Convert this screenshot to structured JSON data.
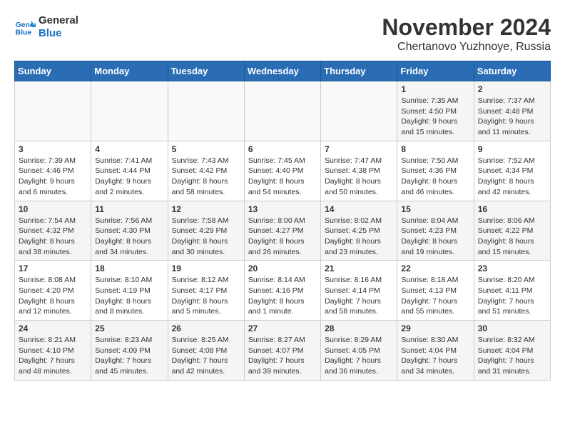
{
  "logo": {
    "line1": "General",
    "line2": "Blue"
  },
  "title": "November 2024",
  "subtitle": "Chertanovo Yuzhnoye, Russia",
  "days_of_week": [
    "Sunday",
    "Monday",
    "Tuesday",
    "Wednesday",
    "Thursday",
    "Friday",
    "Saturday"
  ],
  "weeks": [
    [
      {
        "day": "",
        "info": ""
      },
      {
        "day": "",
        "info": ""
      },
      {
        "day": "",
        "info": ""
      },
      {
        "day": "",
        "info": ""
      },
      {
        "day": "",
        "info": ""
      },
      {
        "day": "1",
        "info": "Sunrise: 7:35 AM\nSunset: 4:50 PM\nDaylight: 9 hours and 15 minutes."
      },
      {
        "day": "2",
        "info": "Sunrise: 7:37 AM\nSunset: 4:48 PM\nDaylight: 9 hours and 11 minutes."
      }
    ],
    [
      {
        "day": "3",
        "info": "Sunrise: 7:39 AM\nSunset: 4:46 PM\nDaylight: 9 hours and 6 minutes."
      },
      {
        "day": "4",
        "info": "Sunrise: 7:41 AM\nSunset: 4:44 PM\nDaylight: 9 hours and 2 minutes."
      },
      {
        "day": "5",
        "info": "Sunrise: 7:43 AM\nSunset: 4:42 PM\nDaylight: 8 hours and 58 minutes."
      },
      {
        "day": "6",
        "info": "Sunrise: 7:45 AM\nSunset: 4:40 PM\nDaylight: 8 hours and 54 minutes."
      },
      {
        "day": "7",
        "info": "Sunrise: 7:47 AM\nSunset: 4:38 PM\nDaylight: 8 hours and 50 minutes."
      },
      {
        "day": "8",
        "info": "Sunrise: 7:50 AM\nSunset: 4:36 PM\nDaylight: 8 hours and 46 minutes."
      },
      {
        "day": "9",
        "info": "Sunrise: 7:52 AM\nSunset: 4:34 PM\nDaylight: 8 hours and 42 minutes."
      }
    ],
    [
      {
        "day": "10",
        "info": "Sunrise: 7:54 AM\nSunset: 4:32 PM\nDaylight: 8 hours and 38 minutes."
      },
      {
        "day": "11",
        "info": "Sunrise: 7:56 AM\nSunset: 4:30 PM\nDaylight: 8 hours and 34 minutes."
      },
      {
        "day": "12",
        "info": "Sunrise: 7:58 AM\nSunset: 4:29 PM\nDaylight: 8 hours and 30 minutes."
      },
      {
        "day": "13",
        "info": "Sunrise: 8:00 AM\nSunset: 4:27 PM\nDaylight: 8 hours and 26 minutes."
      },
      {
        "day": "14",
        "info": "Sunrise: 8:02 AM\nSunset: 4:25 PM\nDaylight: 8 hours and 23 minutes."
      },
      {
        "day": "15",
        "info": "Sunrise: 8:04 AM\nSunset: 4:23 PM\nDaylight: 8 hours and 19 minutes."
      },
      {
        "day": "16",
        "info": "Sunrise: 8:06 AM\nSunset: 4:22 PM\nDaylight: 8 hours and 15 minutes."
      }
    ],
    [
      {
        "day": "17",
        "info": "Sunrise: 8:08 AM\nSunset: 4:20 PM\nDaylight: 8 hours and 12 minutes."
      },
      {
        "day": "18",
        "info": "Sunrise: 8:10 AM\nSunset: 4:19 PM\nDaylight: 8 hours and 8 minutes."
      },
      {
        "day": "19",
        "info": "Sunrise: 8:12 AM\nSunset: 4:17 PM\nDaylight: 8 hours and 5 minutes."
      },
      {
        "day": "20",
        "info": "Sunrise: 8:14 AM\nSunset: 4:16 PM\nDaylight: 8 hours and 1 minute."
      },
      {
        "day": "21",
        "info": "Sunrise: 8:16 AM\nSunset: 4:14 PM\nDaylight: 7 hours and 58 minutes."
      },
      {
        "day": "22",
        "info": "Sunrise: 8:18 AM\nSunset: 4:13 PM\nDaylight: 7 hours and 55 minutes."
      },
      {
        "day": "23",
        "info": "Sunrise: 8:20 AM\nSunset: 4:11 PM\nDaylight: 7 hours and 51 minutes."
      }
    ],
    [
      {
        "day": "24",
        "info": "Sunrise: 8:21 AM\nSunset: 4:10 PM\nDaylight: 7 hours and 48 minutes."
      },
      {
        "day": "25",
        "info": "Sunrise: 8:23 AM\nSunset: 4:09 PM\nDaylight: 7 hours and 45 minutes."
      },
      {
        "day": "26",
        "info": "Sunrise: 8:25 AM\nSunset: 4:08 PM\nDaylight: 7 hours and 42 minutes."
      },
      {
        "day": "27",
        "info": "Sunrise: 8:27 AM\nSunset: 4:07 PM\nDaylight: 7 hours and 39 minutes."
      },
      {
        "day": "28",
        "info": "Sunrise: 8:29 AM\nSunset: 4:05 PM\nDaylight: 7 hours and 36 minutes."
      },
      {
        "day": "29",
        "info": "Sunrise: 8:30 AM\nSunset: 4:04 PM\nDaylight: 7 hours and 34 minutes."
      },
      {
        "day": "30",
        "info": "Sunrise: 8:32 AM\nSunset: 4:04 PM\nDaylight: 7 hours and 31 minutes."
      }
    ]
  ]
}
